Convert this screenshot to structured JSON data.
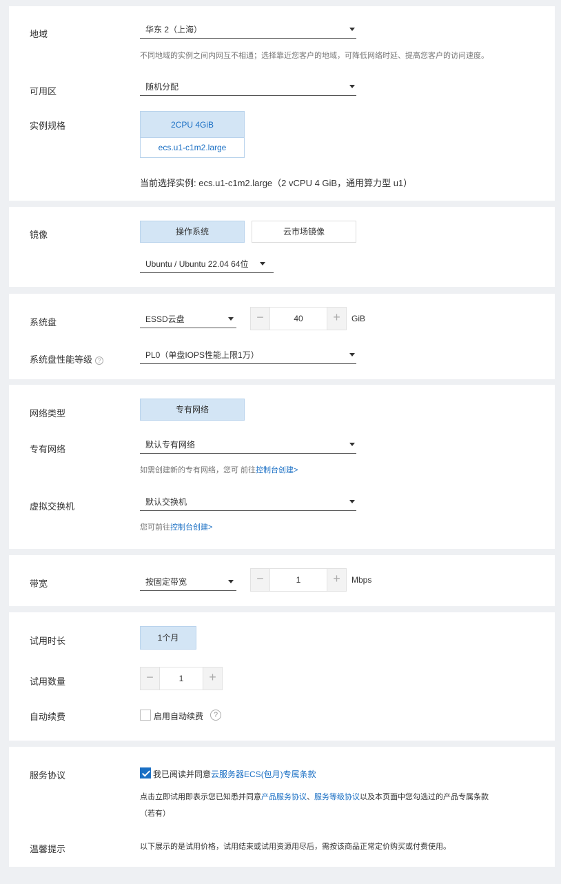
{
  "region": {
    "label": "地域",
    "value": "华东 2（上海）",
    "hint": "不同地域的实例之间内网互不相通；选择靠近您客户的地域，可降低网络时延、提高您客户的访问速度。"
  },
  "zone": {
    "label": "可用区",
    "value": "随机分配"
  },
  "instance": {
    "label": "实例规格",
    "spec": "2CPU 4GiB",
    "type": "ecs.u1-c1m2.large",
    "current": "当前选择实例: ecs.u1-c1m2.large（2 vCPU 4 GiB，通用算力型 u1）"
  },
  "image": {
    "label": "镜像",
    "tabs": [
      "操作系统",
      "云市场镜像"
    ],
    "value": "Ubuntu / Ubuntu 22.04 64位"
  },
  "system_disk": {
    "label": "系统盘",
    "type": "ESSD云盘",
    "size": "40",
    "unit": "GiB",
    "perf_label": "系统盘性能等级",
    "perf_value": "PL0（单盘IOPS性能上限1万）",
    "help": "?"
  },
  "network": {
    "type_label": "网络类型",
    "type_value": "专有网络",
    "vpc_label": "专有网络",
    "vpc_value": "默认专有网络",
    "vpc_hint_prefix": "如需创建新的专有网络，您可 前往",
    "vpc_hint_link": "控制台创建>",
    "vswitch_label": "虚拟交换机",
    "vswitch_value": "默认交换机",
    "vswitch_hint_prefix": "您可前往",
    "vswitch_hint_link": "控制台创建>"
  },
  "bandwidth": {
    "label": "带宽",
    "mode": "按固定带宽",
    "value": "1",
    "unit": "Mbps"
  },
  "trial": {
    "duration_label": "试用时长",
    "duration_value": "1个月",
    "qty_label": "试用数量",
    "qty_value": "1",
    "renew_label": "自动续费",
    "renew_checkbox": "启用自动续费",
    "help": "?"
  },
  "agreement": {
    "label": "服务协议",
    "check_prefix": "我已阅读并同意",
    "check_link": "云服务器ECS(包月)专属条款",
    "note_1": "点击立即试用即表示您已知悉并同意",
    "note_link_1": "产品服务协议",
    "note_sep": "、",
    "note_link_2": "服务等级协议",
    "note_2": "以及本页面中您勾选过的产品专属条款",
    "note_3": "（若有）"
  },
  "tip": {
    "label": "温馨提示",
    "text": "以下展示的是试用价格，试用结束或试用资源用尽后，需按该商品正常定价购买或付费使用。"
  }
}
